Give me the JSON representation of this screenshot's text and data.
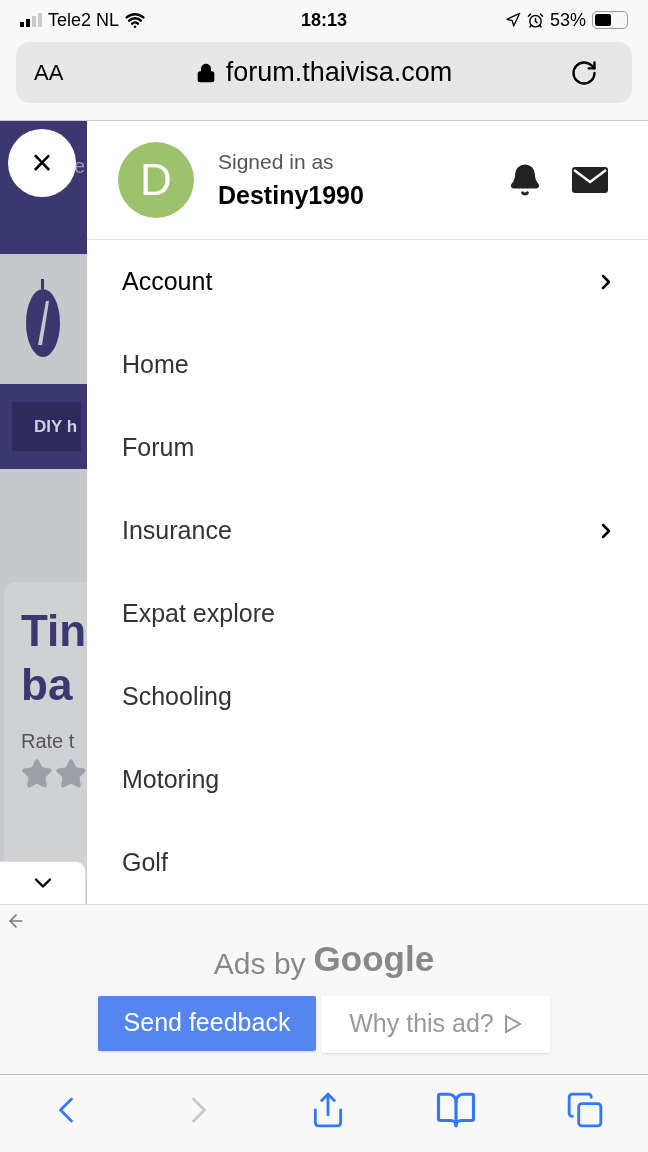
{
  "status_bar": {
    "carrier": "Tele2 NL",
    "time": "18:13",
    "battery": "53%"
  },
  "address_bar": {
    "text_size_button": "AA",
    "url": "forum.thaivisa.com"
  },
  "background_page": {
    "header_text": "e",
    "tag": "DIY h",
    "title_lines": [
      "Tin",
      "ba"
    ],
    "rate_label": "Rate t",
    "close_symbol": "×"
  },
  "menu": {
    "avatar_letter": "D",
    "signed_in_label": "Signed in as",
    "username": "Destiny1990",
    "items": [
      {
        "label": "Account",
        "has_submenu": true
      },
      {
        "label": "Home",
        "has_submenu": false
      },
      {
        "label": "Forum",
        "has_submenu": false
      },
      {
        "label": "Insurance",
        "has_submenu": true
      },
      {
        "label": "Expat explore",
        "has_submenu": false
      },
      {
        "label": "Schooling",
        "has_submenu": false
      },
      {
        "label": "Motoring",
        "has_submenu": false
      },
      {
        "label": "Golf",
        "has_submenu": false
      }
    ]
  },
  "ad": {
    "ads_by": "Ads by",
    "brand": "Google",
    "buttons": [
      "Send feedback",
      "Why this ad?"
    ]
  },
  "toolbar": {
    "back_enabled": true,
    "forward_enabled": false
  }
}
